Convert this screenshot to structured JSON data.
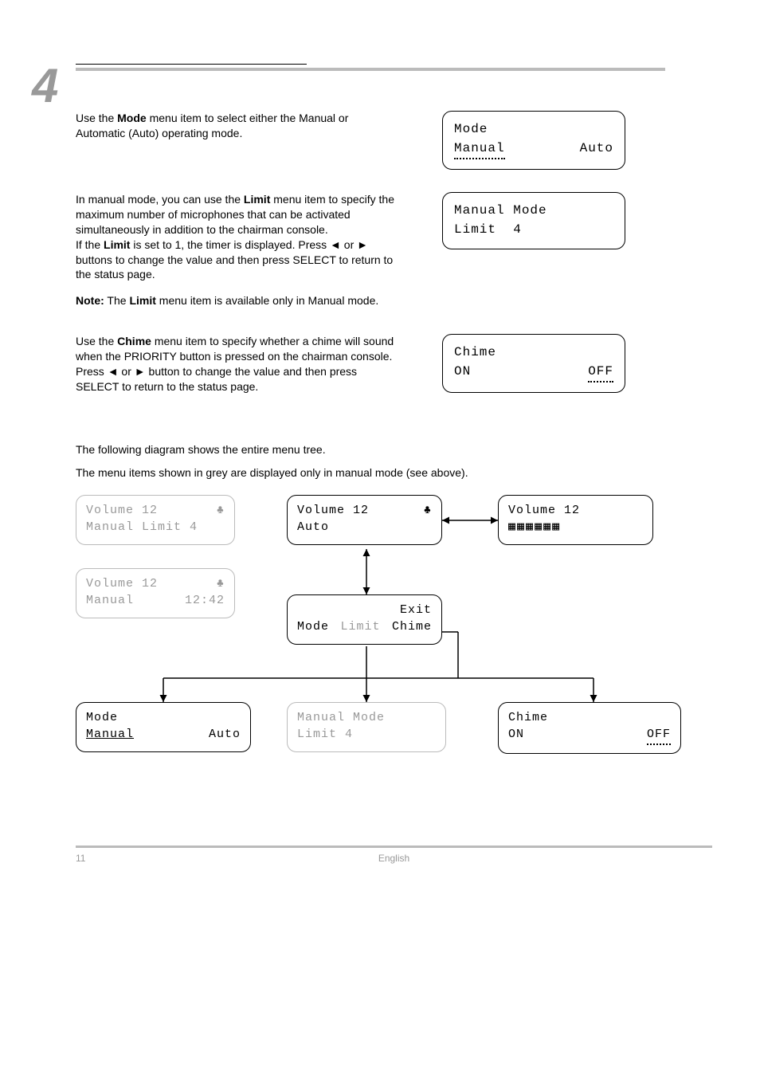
{
  "chapter_number": "4",
  "mode_section": {
    "paragraph": [
      "Use the ",
      "Mode",
      " menu item to select either the Manual or Automatic (Auto) operating mode."
    ],
    "lcd": {
      "title": "Mode",
      "opt1": "Manual",
      "opt2": "Auto"
    }
  },
  "limit_section": {
    "para1": [
      "In manual mode, you can use the ",
      "Limit",
      " menu item to specify the maximum number of microphones that can be activated simultaneously in addition to the chairman console."
    ],
    "para2_a": "If the ",
    "para2_b": "Limit",
    "para2_c": " is set to 1, the timer is displayed. Press ",
    "para2_left": "◄",
    "para2_mid": " or ",
    "para2_right": "►",
    "para2_end": " buttons to change the value and then press SELECT to return to the status page.",
    "note_label": "Note:",
    "note_rest_a": " The ",
    "note_rest_b": "Limit",
    "note_rest_c": " menu item is available only in Manual mode.",
    "lcd": {
      "title": "Manual Mode",
      "line2_label": "Limit",
      "line2_val": "4"
    }
  },
  "chime_section": {
    "para_a": "Use the ",
    "para_b": "Chime",
    "para_c": " menu item to specify whether a chime will sound when the PRIORITY button is pressed on the chairman console. Press ",
    "para_left": "◄",
    "para_mid": " or ",
    "para_right": "►",
    "para_end": " button to change the value and then press SELECT to return to the status page.",
    "lcd": {
      "title": "Chime",
      "opt1": "ON",
      "opt2": "OFF"
    }
  },
  "diagram_section": {
    "intro1": "The following diagram shows the entire menu tree.",
    "intro2": "The menu items shown in grey are displayed only in manual mode (see above).",
    "box_a": {
      "line1_l": "Volume 12",
      "line1_r": "♣",
      "line2": "Manual Limit 4"
    },
    "box_b": {
      "line1_l": "Volume 12",
      "line1_r": "♣",
      "line2_l": "Manual",
      "line2_r": "12:42"
    },
    "box_c": {
      "line1_l": "Volume 12",
      "line1_r": "♣",
      "line2": "Auto"
    },
    "box_d": {
      "line1_l": "Volume 12",
      "line2_blocks": "▦▦▦▦▦▦"
    },
    "box_exit": {
      "line1": "Exit",
      "line2_a": "Mode",
      "line2_b": "Limit",
      "line2_c": "Chime"
    },
    "box_mode": {
      "title": "Mode",
      "opt1": "Manual",
      "opt2": "Auto"
    },
    "box_manual": {
      "title": "Manual Mode",
      "line2": "Limit 4"
    },
    "box_chime": {
      "title": "Chime",
      "opt1": "ON",
      "opt2": "OFF"
    }
  },
  "footer": {
    "page": "11",
    "lang": "English"
  }
}
